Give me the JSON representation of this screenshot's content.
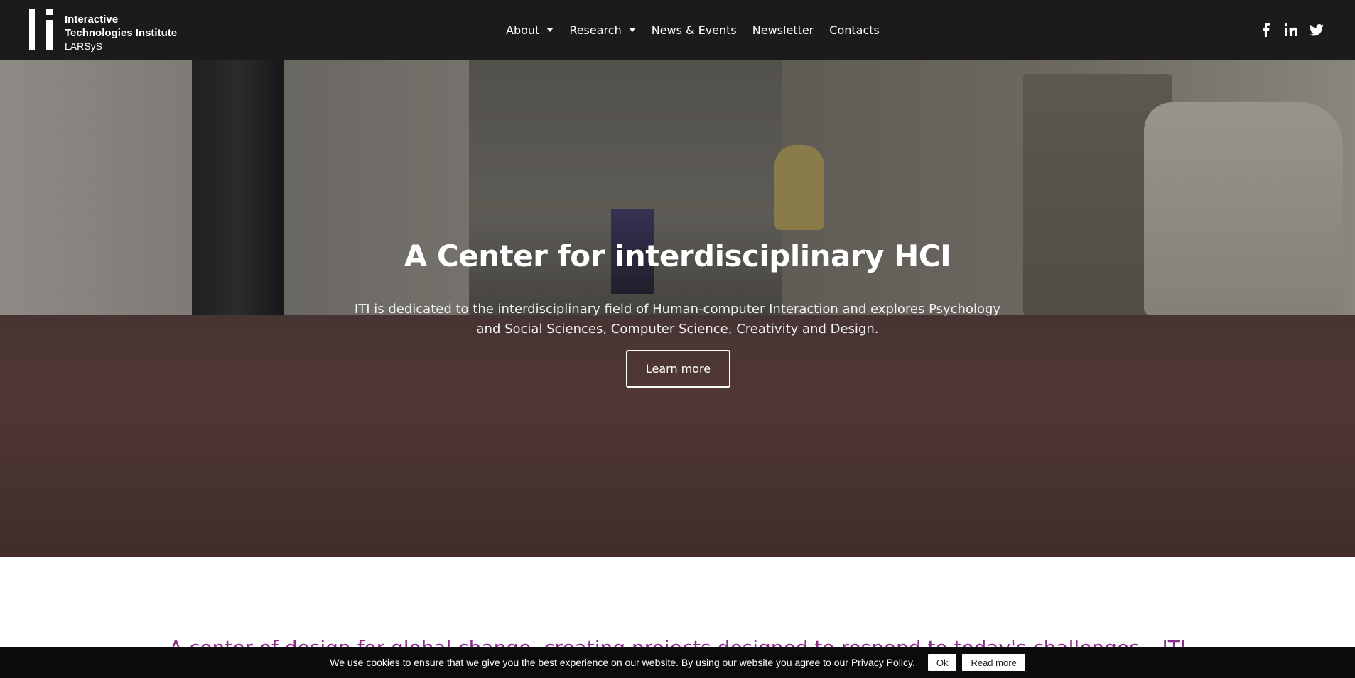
{
  "brand": {
    "line1": "Interactive",
    "line2": "Technologies Institute",
    "line3": "LARSyS"
  },
  "nav": {
    "items": [
      {
        "label": "About",
        "has_dropdown": true
      },
      {
        "label": "Research",
        "has_dropdown": true
      },
      {
        "label": "News & Events",
        "has_dropdown": false
      },
      {
        "label": "Newsletter",
        "has_dropdown": false
      },
      {
        "label": "Contacts",
        "has_dropdown": false
      }
    ]
  },
  "social": {
    "icons": [
      "facebook-icon",
      "linkedin-icon",
      "twitter-icon"
    ]
  },
  "hero": {
    "title": "A Center for interdisciplinary HCI",
    "subtitle": "ITI is dedicated to the interdisciplinary field of Human-computer Interaction and explores Psychology and Social Sciences, Computer Science, Creativity and Design.",
    "button_label": "Learn more"
  },
  "section": {
    "tagline": "A center of design for global change, creating projects designed to respond to today's challenges – ITI"
  },
  "cookie": {
    "text": "We use cookies to ensure that we give you the best experience on our website. By using our website you agree to our Privacy Policy.",
    "ok_label": "Ok",
    "read_more_label": "Read more"
  },
  "colors": {
    "header_bg": "#1b1b1b",
    "accent": "#8a2d8c",
    "cookie_bg": "#0b0b0b"
  }
}
